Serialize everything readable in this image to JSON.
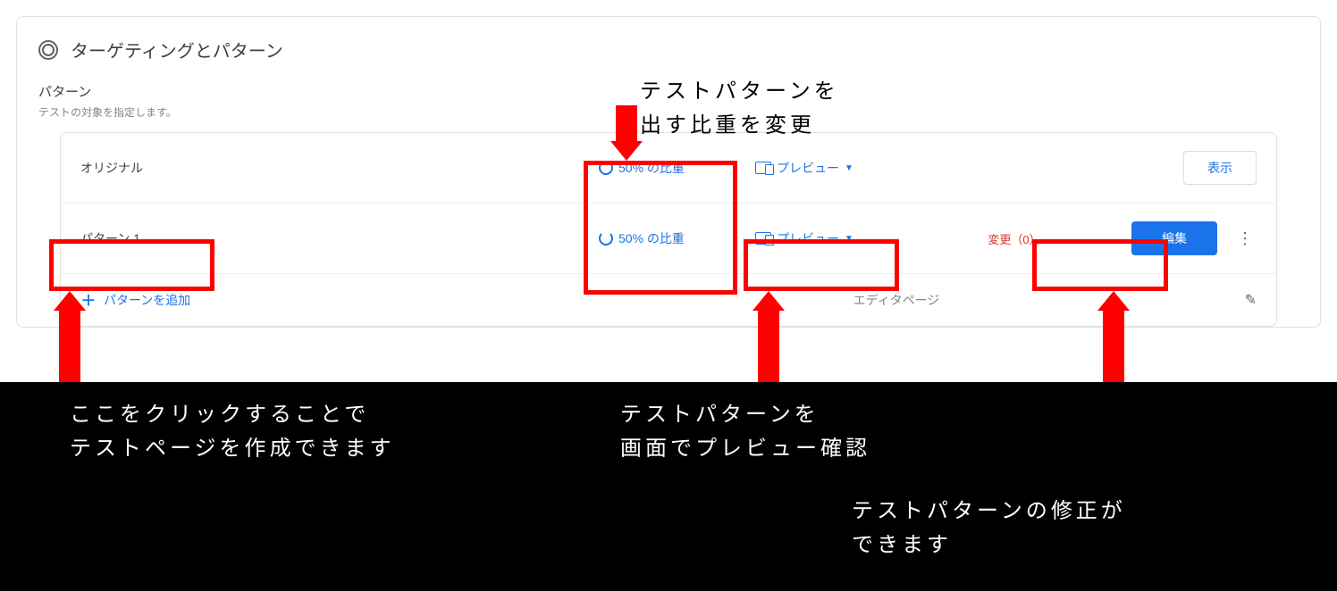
{
  "header": {
    "title": "ターゲティングとパターン"
  },
  "section": {
    "title": "パターン",
    "desc": "テストの対象を指定します。"
  },
  "rows": [
    {
      "name": "オリジナル",
      "weight": "50% の比重",
      "preview": "プレビュー",
      "action": "表示"
    },
    {
      "name": "パターン 1",
      "weight": "50% の比重",
      "preview": "プレビュー",
      "change": "変更（0）",
      "action": "編集"
    }
  ],
  "footer": {
    "add": "パターンを追加",
    "editor": "エディタページ"
  },
  "annotations": {
    "weight": "テストパターンを\n出す比重を変更",
    "name": "ここをクリックすることで\nテストページを作成できます",
    "preview": "テストパターンを\n画面でプレビュー確認",
    "edit": "テストパターンの修正が\nできます"
  }
}
